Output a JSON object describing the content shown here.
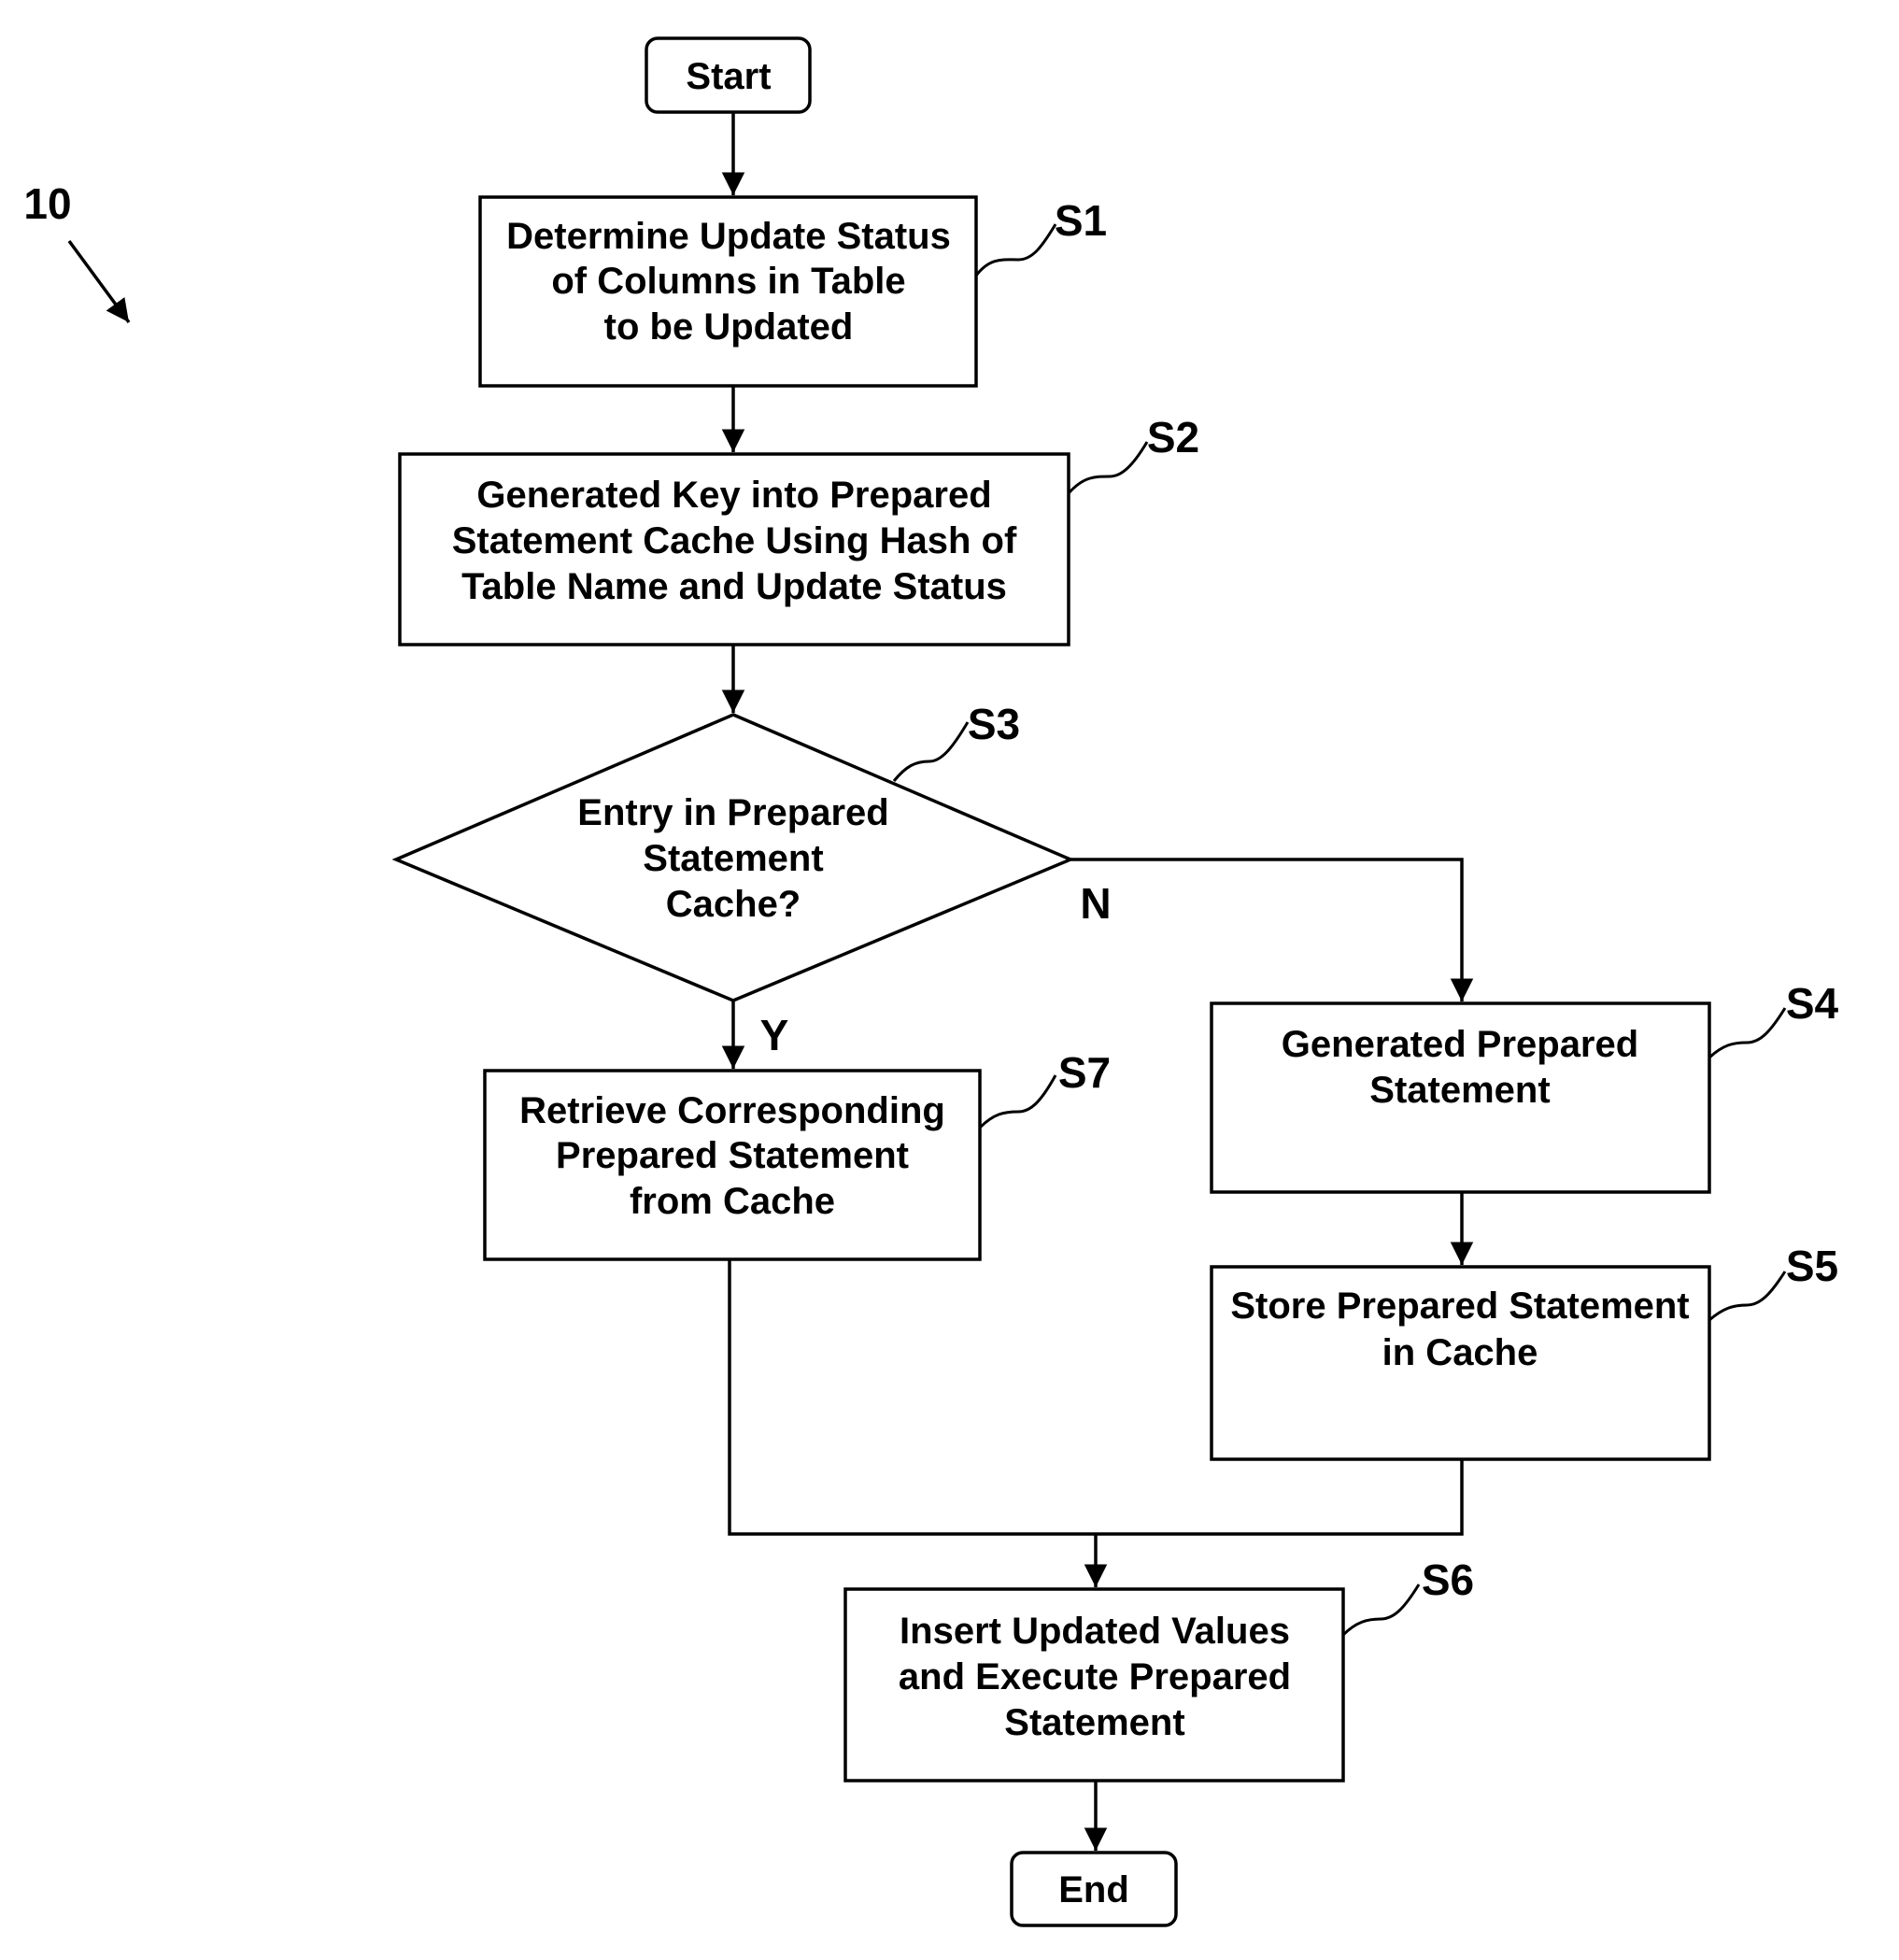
{
  "figure": {
    "reference_number": "10"
  },
  "nodes": {
    "start": {
      "label": "Start"
    },
    "s1": {
      "ref": "S1",
      "lines": [
        "Determine Update Status",
        "of Columns in Table",
        "to be Updated"
      ]
    },
    "s2": {
      "ref": "S2",
      "lines": [
        "Generated Key into Prepared",
        "Statement Cache Using Hash of",
        "Table Name and Update Status"
      ]
    },
    "s3": {
      "ref": "S3",
      "lines": [
        "Entry in Prepared",
        "Statement",
        "Cache?"
      ],
      "yes_label": "Y",
      "no_label": "N"
    },
    "s4": {
      "ref": "S4",
      "lines": [
        "Generated Prepared",
        "Statement"
      ]
    },
    "s5": {
      "ref": "S5",
      "lines": [
        "Store Prepared Statement",
        "in Cache"
      ]
    },
    "s6": {
      "ref": "S6",
      "lines": [
        "Insert Updated Values",
        "and Execute Prepared",
        "Statement"
      ]
    },
    "s7": {
      "ref": "S7",
      "lines": [
        "Retrieve Corresponding",
        "Prepared Statement",
        "from Cache"
      ]
    },
    "end": {
      "label": "End"
    }
  },
  "colors": {
    "stroke": "#000000",
    "background": "#ffffff"
  }
}
